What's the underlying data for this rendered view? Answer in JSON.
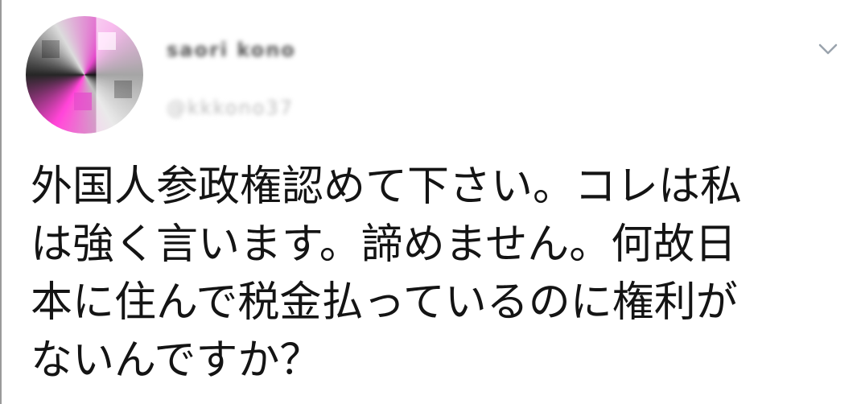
{
  "tweet": {
    "display_name": "saori kono",
    "handle": "@kkkono37",
    "menu_icon": "chevron-down-icon",
    "text_lines": [
      "外国人参政権認めて下さい。コレは私",
      "は強く言います。諦めません。何故日",
      "本に住んで税金払っているのに権利が",
      "ないんですか？"
    ]
  },
  "colors": {
    "text": "#141414",
    "avatar_accent": "#e04cc8",
    "chevron": "#9aa3ad"
  }
}
